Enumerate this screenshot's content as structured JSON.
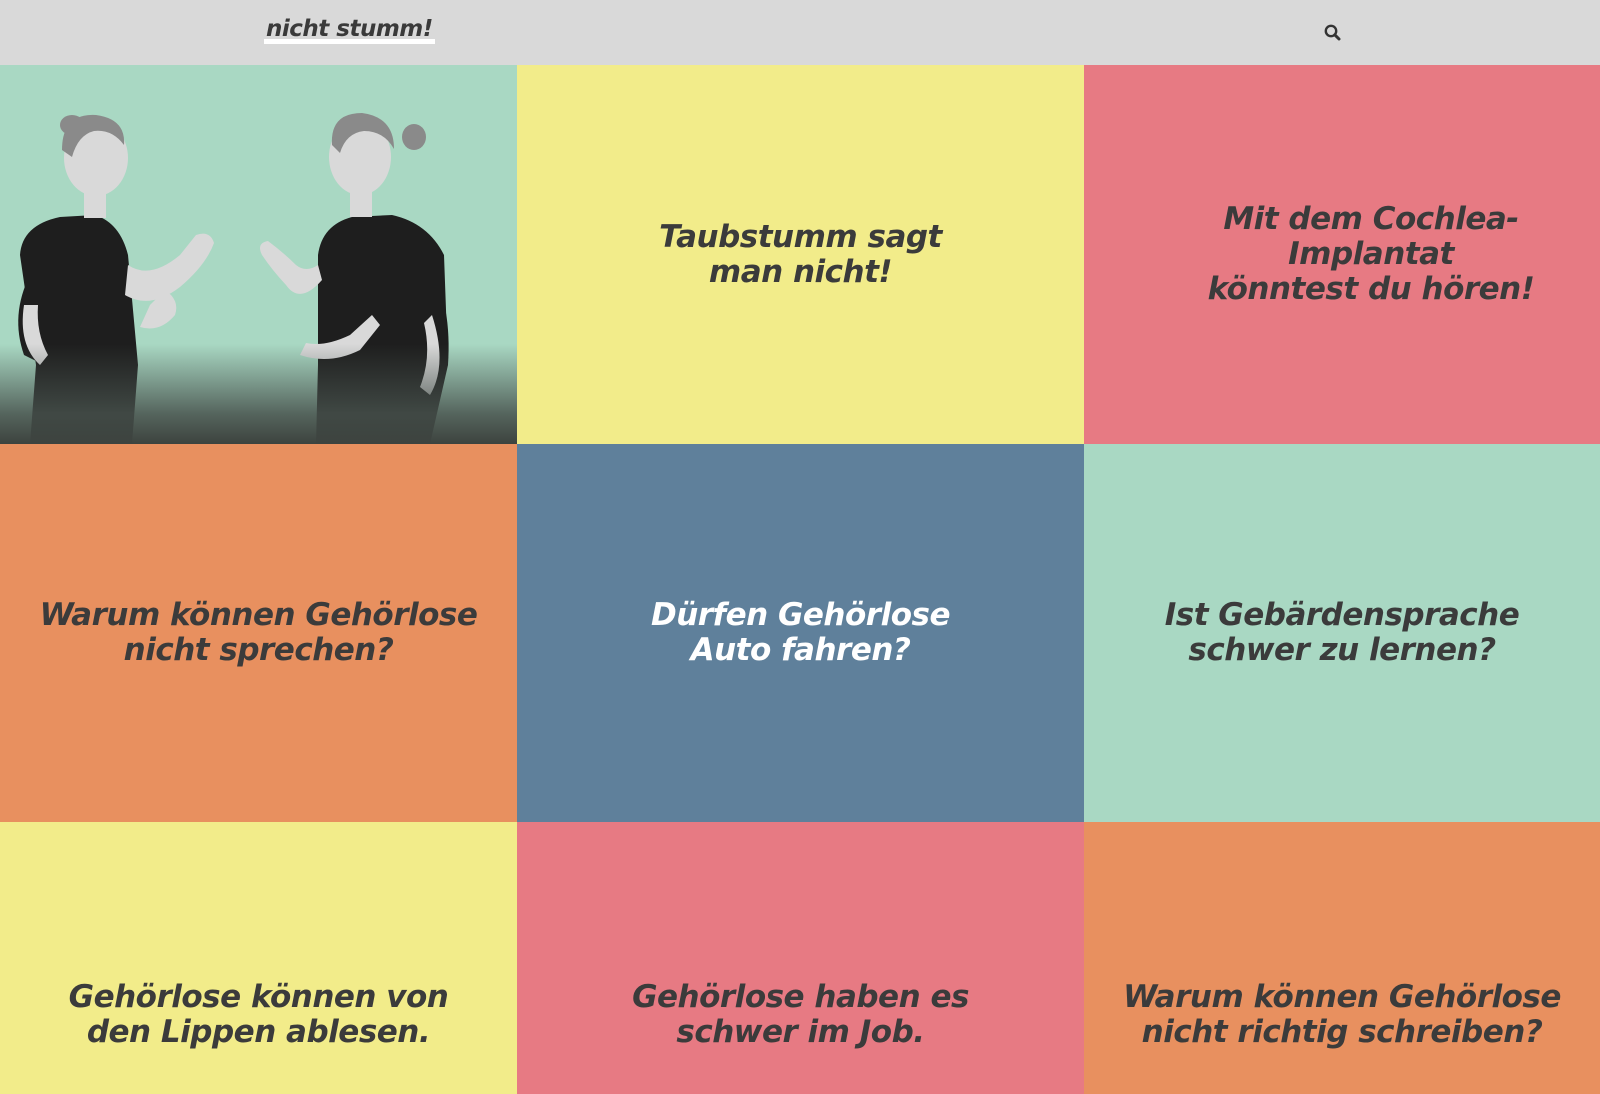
{
  "header": {
    "logo": "nicht stumm!",
    "search_icon": "search-icon"
  },
  "colors": {
    "header_bg": "#d9d9d9",
    "mint": "#a9d8c3",
    "yellow": "#f2ec8a",
    "red": "#e77a83",
    "orange": "#e8905f",
    "blue": "#5f809b",
    "text_dark": "#3b3b3b",
    "text_light": "#ffffff"
  },
  "tiles": [
    {
      "type": "photo",
      "description_icon": "sign-language-photo"
    },
    {
      "text": "Taubstumm sagt\nman nicht!",
      "color": "#f2ec8a"
    },
    {
      "text": "Mit dem Cochlea-Implantat\nkönntest du hören!",
      "color": "#e77a83"
    },
    {
      "text": "Warum können Gehörlose\nnicht sprechen?",
      "color": "#e8905f"
    },
    {
      "text": "Dürfen Gehörlose\nAuto fahren?",
      "color": "#5f809b"
    },
    {
      "text": "Ist Gebärdensprache\nschwer zu lernen?",
      "color": "#a9d8c3"
    },
    {
      "text": "Gehörlose können von\nden Lippen ablesen.",
      "color": "#f2ec8a"
    },
    {
      "text": "Gehörlose haben es\nschwer im Job.",
      "color": "#e77a83"
    },
    {
      "text": "Warum können Gehörlose\nnicht richtig schreiben?",
      "color": "#e8905f"
    }
  ]
}
